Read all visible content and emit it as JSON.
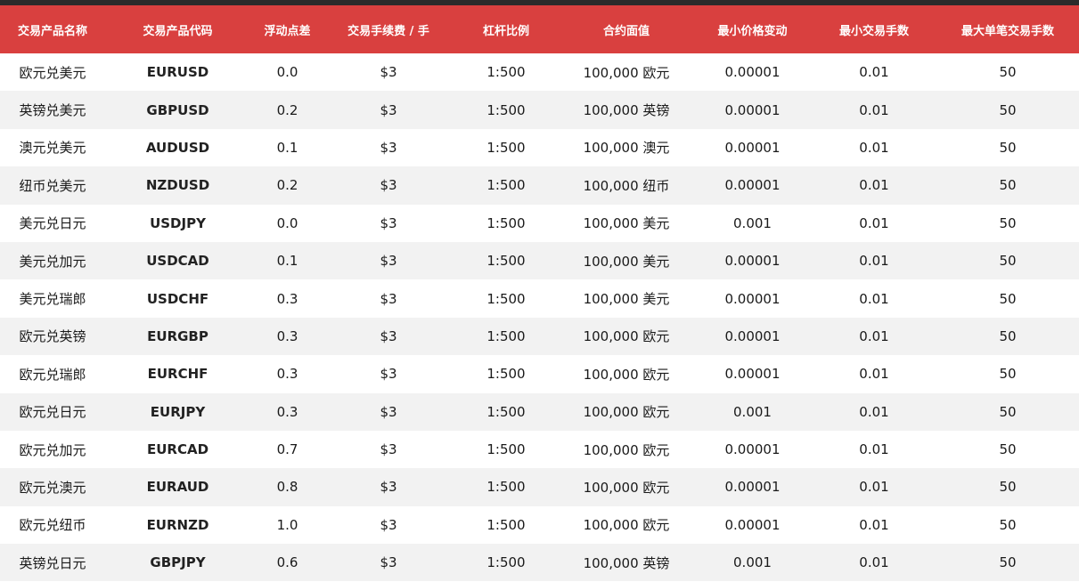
{
  "colors": {
    "header_bg": "#d9403f",
    "header_text": "#ffffff",
    "row_alt_bg": "#f2f2f2",
    "top_strip": "#2b2b2b"
  },
  "table": {
    "headers": [
      "交易产品名称",
      "交易产品代码",
      "浮动点差",
      "交易手续费 / 手",
      "杠杆比例",
      "合约面值",
      "最小价格变动",
      "最小交易手数",
      "最大单笔交易手数"
    ],
    "rows": [
      [
        "欧元兑美元",
        "EURUSD",
        "0.0",
        "$3",
        "1:500",
        "100,000 欧元",
        "0.00001",
        "0.01",
        "50"
      ],
      [
        "英镑兑美元",
        "GBPUSD",
        "0.2",
        "$3",
        "1:500",
        "100,000 英镑",
        "0.00001",
        "0.01",
        "50"
      ],
      [
        "澳元兑美元",
        "AUDUSD",
        "0.1",
        "$3",
        "1:500",
        "100,000 澳元",
        "0.00001",
        "0.01",
        "50"
      ],
      [
        "纽币兑美元",
        "NZDUSD",
        "0.2",
        "$3",
        "1:500",
        "100,000 纽币",
        "0.00001",
        "0.01",
        "50"
      ],
      [
        "美元兑日元",
        "USDJPY",
        "0.0",
        "$3",
        "1:500",
        "100,000 美元",
        "0.001",
        "0.01",
        "50"
      ],
      [
        "美元兑加元",
        "USDCAD",
        "0.1",
        "$3",
        "1:500",
        "100,000 美元",
        "0.00001",
        "0.01",
        "50"
      ],
      [
        "美元兑瑞郎",
        "USDCHF",
        "0.3",
        "$3",
        "1:500",
        "100,000 美元",
        "0.00001",
        "0.01",
        "50"
      ],
      [
        "欧元兑英镑",
        "EURGBP",
        "0.3",
        "$3",
        "1:500",
        "100,000 欧元",
        "0.00001",
        "0.01",
        "50"
      ],
      [
        "欧元兑瑞郎",
        "EURCHF",
        "0.3",
        "$3",
        "1:500",
        "100,000 欧元",
        "0.00001",
        "0.01",
        "50"
      ],
      [
        "欧元兑日元",
        "EURJPY",
        "0.3",
        "$3",
        "1:500",
        "100,000 欧元",
        "0.001",
        "0.01",
        "50"
      ],
      [
        "欧元兑加元",
        "EURCAD",
        "0.7",
        "$3",
        "1:500",
        "100,000 欧元",
        "0.00001",
        "0.01",
        "50"
      ],
      [
        "欧元兑澳元",
        "EURAUD",
        "0.8",
        "$3",
        "1:500",
        "100,000 欧元",
        "0.00001",
        "0.01",
        "50"
      ],
      [
        "欧元兑纽币",
        "EURNZD",
        "1.0",
        "$3",
        "1:500",
        "100,000 欧元",
        "0.00001",
        "0.01",
        "50"
      ],
      [
        "英镑兑日元",
        "GBPJPY",
        "0.6",
        "$3",
        "1:500",
        "100,000 英镑",
        "0.001",
        "0.01",
        "50"
      ]
    ]
  }
}
